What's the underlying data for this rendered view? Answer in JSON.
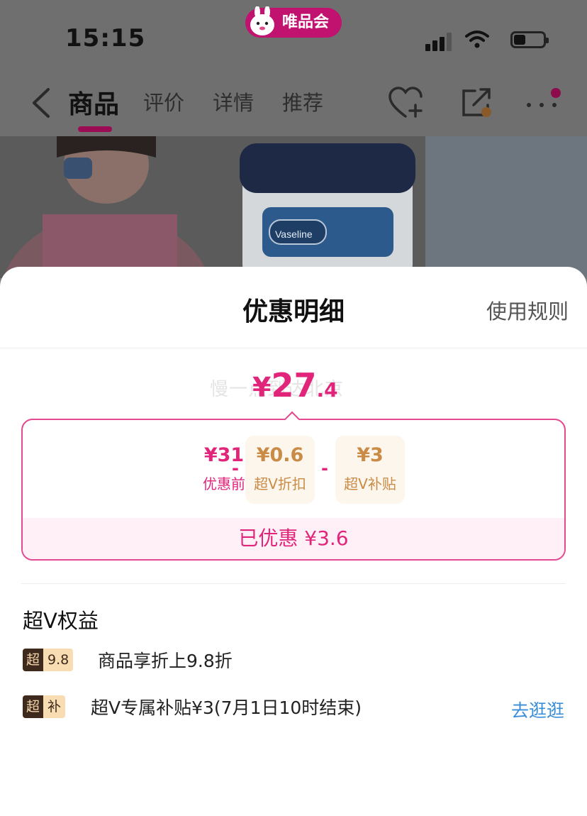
{
  "status_bar": {
    "time": "15:15",
    "vip_app_label": "唯品会"
  },
  "nav": {
    "tabs": [
      "商品",
      "评价",
      "详情",
      "推荐"
    ],
    "active_tab": "商品"
  },
  "sheet": {
    "title": "优惠明细",
    "rules_link": "使用规则",
    "ghost_text": "慢一点到达北京",
    "final_price": {
      "currency": "¥",
      "integer": "27",
      "decimal": ".4"
    },
    "breakdown": [
      {
        "amount": "¥31",
        "label": "优惠前",
        "style": "pink"
      },
      {
        "amount": "¥0.6",
        "label": "超V折扣",
        "style": "gold"
      },
      {
        "amount": "¥3",
        "label": "超V补贴",
        "style": "gold"
      }
    ],
    "operator": "-",
    "saved_text": "已优惠 ¥3.6",
    "section_title": "超V权益",
    "benefits": [
      {
        "badge_left": "超V",
        "badge_right": "9.8折",
        "text": "商品享折上9.8折"
      },
      {
        "badge_left": "超V",
        "badge_right": "补贴",
        "text": "超V专属补贴¥3(7月1日10时结束)"
      }
    ],
    "go_link": "去逛逛"
  },
  "colors": {
    "accent_pink": "#e1257a",
    "gold": "#c98b45",
    "link_blue": "#3a8ed8"
  }
}
